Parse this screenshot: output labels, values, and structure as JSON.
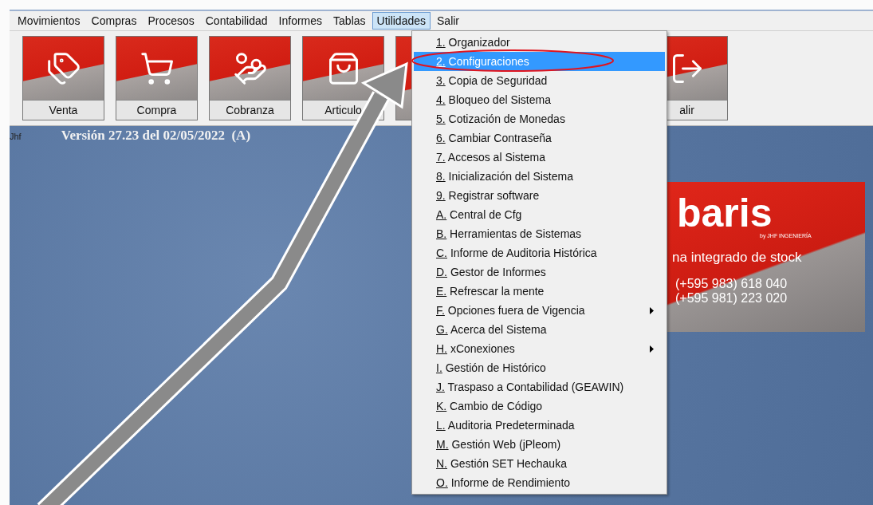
{
  "menubar": [
    {
      "label": "Movimientos",
      "selected": false
    },
    {
      "label": "Compras",
      "selected": false
    },
    {
      "label": "Procesos",
      "selected": false
    },
    {
      "label": "Contabilidad",
      "selected": false
    },
    {
      "label": "Informes",
      "selected": false
    },
    {
      "label": "Tablas",
      "selected": false
    },
    {
      "label": "Utilidades",
      "selected": true
    },
    {
      "label": "Salir",
      "selected": false
    }
  ],
  "toolbar": [
    {
      "kind": "tile",
      "label": "Venta"
    },
    {
      "kind": "tile",
      "label": "Compra"
    },
    {
      "kind": "tile",
      "label": "Cobranza"
    },
    {
      "kind": "tile",
      "label": "Articulo"
    },
    {
      "kind": "hidden"
    },
    {
      "kind": "tile",
      "label": "alir"
    }
  ],
  "desktop": {
    "user": "Jhf",
    "version": "Versión 27.23 del 02/05/2022  (A)",
    "banner": {
      "logo": "baris",
      "by": "by JHF INGENIERÍA",
      "tagline": "na integrado de stock",
      "phones": [
        "(+595 983) 618 040",
        "(+595 981) 223 020"
      ]
    }
  },
  "menu": [
    {
      "label": "1. Organizador",
      "selected": false,
      "submenu": false
    },
    {
      "label": "2. Configuraciones",
      "selected": true,
      "submenu": false
    },
    {
      "label": "3. Copia de Seguridad",
      "selected": false,
      "submenu": false
    },
    {
      "label": "4. Bloqueo del Sistema",
      "selected": false,
      "submenu": false
    },
    {
      "label": "5. Cotización de Monedas",
      "selected": false,
      "submenu": false
    },
    {
      "label": "6. Cambiar Contraseña",
      "selected": false,
      "submenu": false
    },
    {
      "label": "7. Accesos al Sistema",
      "selected": false,
      "submenu": false
    },
    {
      "label": "8. Inicialización del Sistema",
      "selected": false,
      "submenu": false
    },
    {
      "label": "9. Registrar software",
      "selected": false,
      "submenu": false
    },
    {
      "label": "A. Central de Cfg",
      "selected": false,
      "submenu": false
    },
    {
      "label": "B. Herramientas de Sistemas",
      "selected": false,
      "submenu": false
    },
    {
      "label": "C. Informe de Auditoria Histórica",
      "selected": false,
      "submenu": false
    },
    {
      "label": "D. Gestor de Informes",
      "selected": false,
      "submenu": false
    },
    {
      "label": "E. Refrescar la mente",
      "selected": false,
      "submenu": false
    },
    {
      "label": "F. Opciones fuera de Vigencia",
      "selected": false,
      "submenu": true
    },
    {
      "label": "G. Acerca del Sistema",
      "selected": false,
      "submenu": false
    },
    {
      "label": "H. xConexiones",
      "selected": false,
      "submenu": true
    },
    {
      "label": "I. Gestión de Histórico",
      "selected": false,
      "submenu": false
    },
    {
      "label": "J. Traspaso a Contabilidad (GEAWIN)",
      "selected": false,
      "submenu": false
    },
    {
      "label": "K. Cambio de Código",
      "selected": false,
      "submenu": false
    },
    {
      "label": "L. Auditoria Predeterminada",
      "selected": false,
      "submenu": false
    },
    {
      "label": "M. Gestión Web (jPleom)",
      "selected": false,
      "submenu": false
    },
    {
      "label": "N. Gestión SET Hechauka",
      "selected": false,
      "submenu": false
    },
    {
      "label": "O. Informe de Rendimiento",
      "selected": false,
      "submenu": false
    }
  ]
}
